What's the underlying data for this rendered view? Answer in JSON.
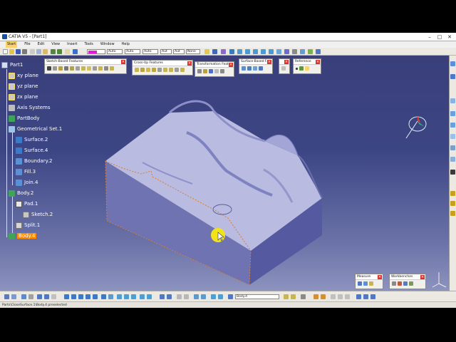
{
  "window": {
    "title": "CATIA V5 - [Part1]",
    "min": "–",
    "max": "□",
    "close": "✕"
  },
  "menu": [
    "Start",
    "File",
    "Edit",
    "View",
    "Insert",
    "Tools",
    "Window",
    "Help"
  ],
  "toolbar": {
    "color_combo": "",
    "linetype_combo": "Auto",
    "thickness_combo": "Auto",
    "weight_combo": "Auto",
    "layer_combo": "Aut",
    "filter_combo": "Aut",
    "none_combo": "None"
  },
  "tree": {
    "root": "Part1",
    "items": [
      {
        "label": "xy plane",
        "type": "plane"
      },
      {
        "label": "yz plane",
        "type": "plane"
      },
      {
        "label": "zx plane",
        "type": "plane"
      },
      {
        "label": "Axis Systems",
        "type": "axis"
      },
      {
        "label": "PartBody",
        "type": "body"
      },
      {
        "label": "Geometrical Set.1",
        "type": "geoset"
      },
      {
        "label": "Surface.2",
        "type": "surface"
      },
      {
        "label": "Surface.4",
        "type": "surface"
      },
      {
        "label": "Boundary.2",
        "type": "boundary"
      },
      {
        "label": "Fill.3",
        "type": "fill"
      },
      {
        "label": "Join.4",
        "type": "join"
      },
      {
        "label": "Body.2",
        "type": "body"
      },
      {
        "label": "Pad.1",
        "type": "pad"
      },
      {
        "label": "Sketch.2",
        "type": "sketch"
      },
      {
        "label": "Split.1",
        "type": "split"
      },
      {
        "label": "Body.4",
        "type": "body",
        "selected": true
      }
    ]
  },
  "floating_toolbars": {
    "sketch_based": "Sketch-Based Features",
    "cross_up": "Cross-Up Features",
    "transformation": "Transformation Feat...",
    "surface_based": "Surface-Based F...",
    "reference": "Reference",
    "measure": "Measure",
    "workbenches": "Workbenches"
  },
  "bottom": {
    "body_combo": "Body.4"
  },
  "status": "Parts\\CloseSurface.1\\Body.4 preselected",
  "colors": {
    "accent_selection": "#ff8a00",
    "viewport_top": "#3a3f7a",
    "viewport_bottom": "#8d93bf",
    "close_red": "#d8332b"
  }
}
